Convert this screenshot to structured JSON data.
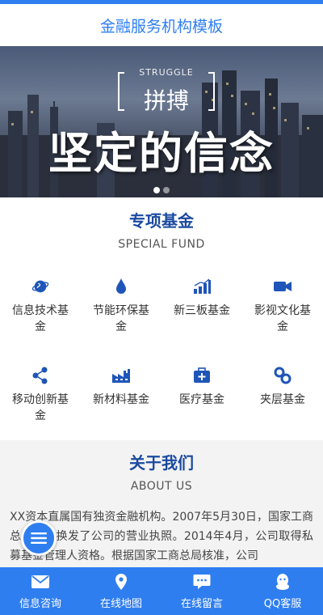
{
  "header": {
    "title": "金融服务机构模板"
  },
  "banner": {
    "kicker": "STRUGGLE",
    "kicker_cn": "拼搏",
    "slogan": "坚定的信念",
    "slides": 2,
    "active_slide": 1
  },
  "fund": {
    "title": "专项基金",
    "subtitle": "SPECIAL FUND",
    "items": [
      {
        "label": "信息技术基金",
        "icon": "globe-icon"
      },
      {
        "label": "节能环保基金",
        "icon": "water-drop-icon"
      },
      {
        "label": "新三板基金",
        "icon": "bar-chart-icon"
      },
      {
        "label": "影视文化基金",
        "icon": "video-camera-icon"
      },
      {
        "label": "移动创新基金",
        "icon": "share-icon"
      },
      {
        "label": "新材料基金",
        "icon": "factory-icon"
      },
      {
        "label": "医疗基金",
        "icon": "medical-kit-icon"
      },
      {
        "label": "夹层基金",
        "icon": "link-icon"
      }
    ]
  },
  "about": {
    "title": "关于我们",
    "subtitle": "ABOUT US",
    "text": "XX资本直属国有独资金融机构。2007年5月30日，国家工商总局正式换发了公司的营业执照。2014年4月，公司取得私募基金管理人资格。根据国家工商总局核准，公司"
  },
  "footer": {
    "items": [
      {
        "label": "信息咨询",
        "icon": "mail-icon"
      },
      {
        "label": "在线地图",
        "icon": "map-pin-icon"
      },
      {
        "label": "在线留言",
        "icon": "chat-bubble-icon"
      },
      {
        "label": "QQ客服",
        "icon": "qq-penguin-icon"
      }
    ]
  },
  "colors": {
    "primary": "#2f7ef0",
    "heading": "#1b4aa0",
    "icon": "#1f55b8"
  }
}
